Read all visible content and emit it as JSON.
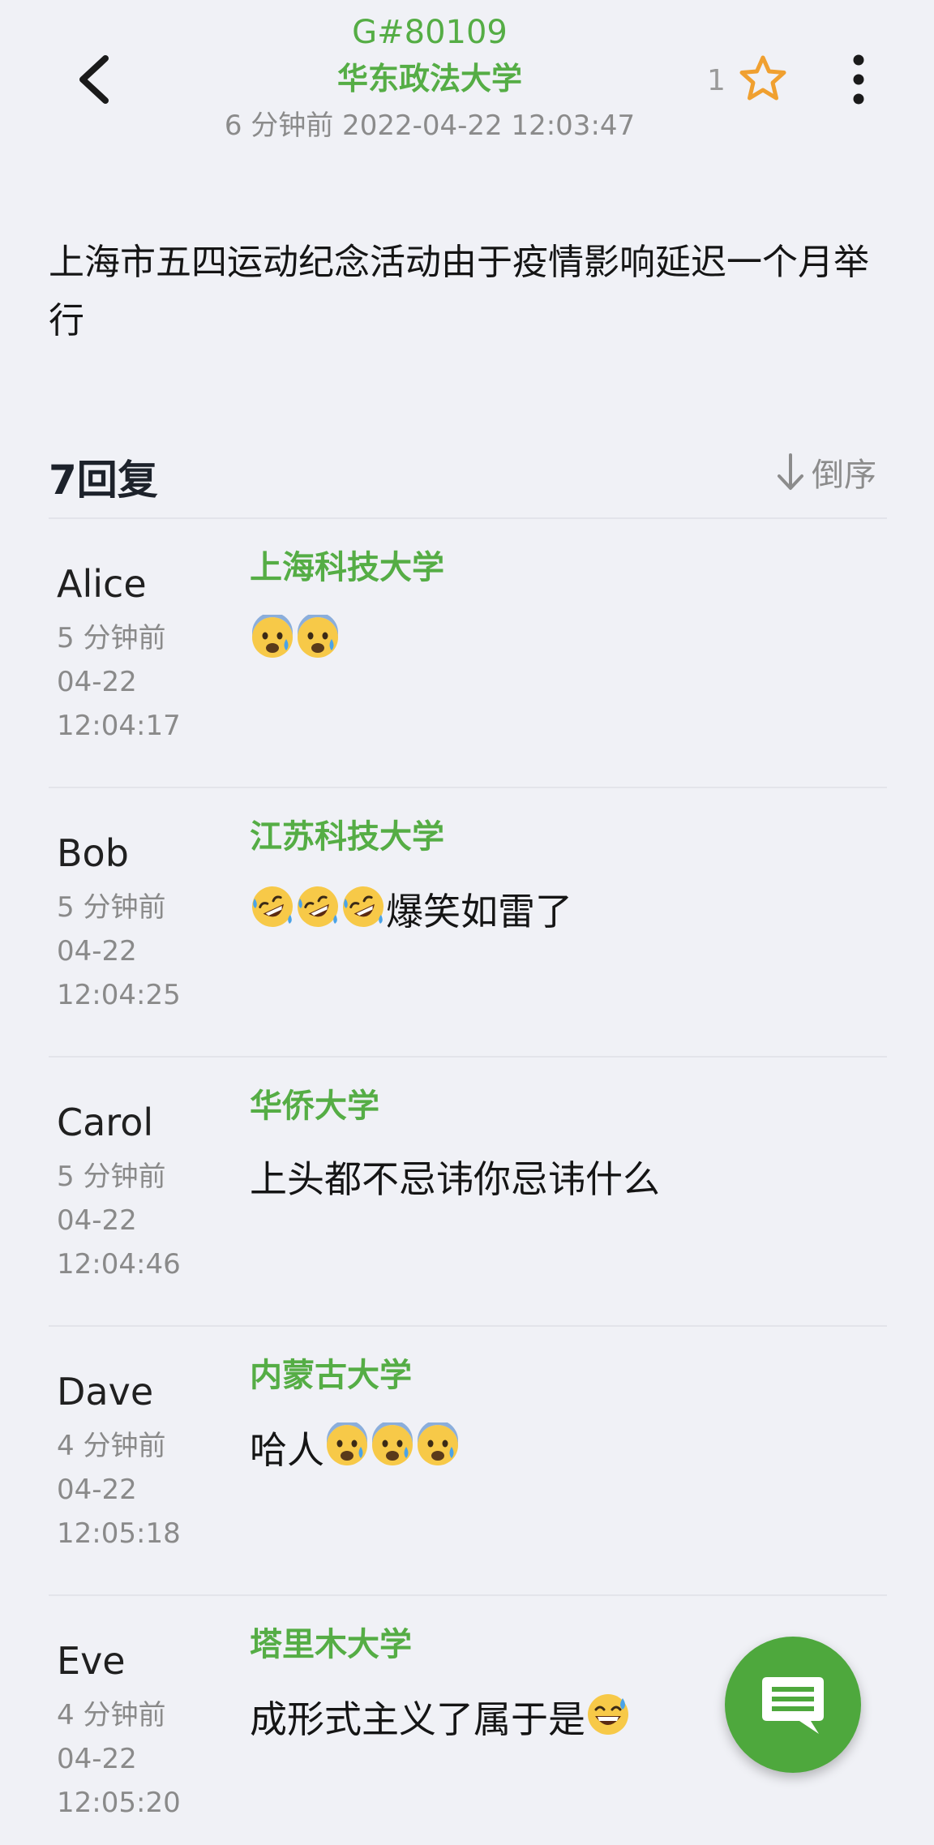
{
  "header": {
    "post_id": "G#80109",
    "school": "华东政法大学",
    "time": "6 分钟前 2022-04-22 12:03:47",
    "star_count": "1"
  },
  "post": {
    "content": "上海市五四运动纪念活动由于疫情影响延迟一个月举行"
  },
  "replies_header": {
    "title": "7回复",
    "sort_label": "倒序"
  },
  "replies": [
    {
      "name": "Alice",
      "relative": "5 分钟前",
      "date": "04-22",
      "time": "12:04:17",
      "school": "上海科技大学",
      "text": "",
      "emoji_before": [
        "anxious-sweat-emoji",
        "anxious-sweat-emoji"
      ]
    },
    {
      "name": "Bob",
      "relative": "5 分钟前",
      "date": "04-22",
      "time": "12:04:25",
      "school": "江苏科技大学",
      "text": "爆笑如雷了",
      "emoji_before": [
        "rofl-emoji",
        "rofl-emoji",
        "rofl-emoji"
      ]
    },
    {
      "name": "Carol",
      "relative": "5 分钟前",
      "date": "04-22",
      "time": "12:04:46",
      "school": "华侨大学",
      "text": "上头都不忌讳你忌讳什么"
    },
    {
      "name": "Dave",
      "relative": "4 分钟前",
      "date": "04-22",
      "time": "12:05:18",
      "school": "内蒙古大学",
      "text": "哈人",
      "emoji_after": [
        "anxious-sweat-emoji",
        "anxious-sweat-emoji",
        "anxious-sweat-emoji"
      ]
    },
    {
      "name": "Eve",
      "relative": "4 分钟前",
      "date": "04-22",
      "time": "12:05:20",
      "school": "塔里木大学",
      "text": "成形式主义了属于是",
      "emoji_after": [
        "grin-sweat-emoji"
      ]
    }
  ],
  "colors": {
    "accent": "#55ad45",
    "fab": "#4ea83d",
    "star": "#f0a030",
    "background": "#f0f1f6"
  },
  "icons": {
    "back": "back-arrow-icon",
    "star": "star-outline-icon",
    "more": "more-vertical-icon",
    "sort": "arrow-down-icon",
    "fab": "comment-icon"
  }
}
